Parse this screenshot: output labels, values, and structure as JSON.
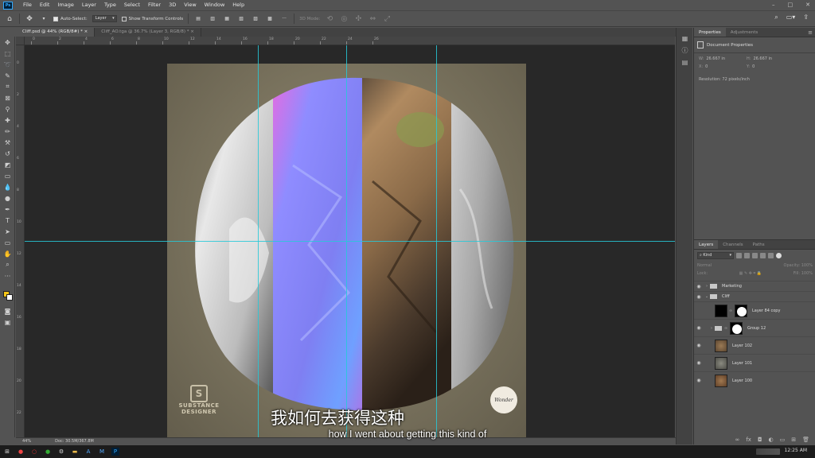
{
  "menubar": {
    "app_logo": "Ps",
    "items": [
      "File",
      "Edit",
      "Image",
      "Layer",
      "Type",
      "Select",
      "Filter",
      "3D",
      "View",
      "Window",
      "Help"
    ],
    "window_controls": [
      "–",
      "□",
      "✕"
    ]
  },
  "options": {
    "auto_select_label": "Auto-Select:",
    "auto_select_value": "Layer",
    "transform_label": "Show Transform Controls",
    "mode_label": "3D Mode:"
  },
  "doc_tabs": [
    {
      "label": "Cliff.psd @ 44% (RGB/8#) *",
      "active": true
    },
    {
      "label": "Cliff_AO.tga @ 36.7% (Layer 3, RGB/8) *",
      "active": false
    }
  ],
  "ruler_top_labels": [
    "0",
    "2",
    "4",
    "6",
    "8",
    "10",
    "12",
    "14",
    "16",
    "18",
    "20",
    "22",
    "24",
    "26"
  ],
  "ruler_left_labels": [
    "0",
    "2",
    "4",
    "6",
    "8",
    "10",
    "12",
    "14",
    "16",
    "18",
    "20",
    "22"
  ],
  "canvas": {
    "logo_substance": "SUBSTANCE",
    "logo_designer": "DESIGNER",
    "logo_mark": "S",
    "stamp_text": "Wonder"
  },
  "subtitles": {
    "cn": "我如何去获得这种",
    "en": "how I went about getting this kind of"
  },
  "status": {
    "zoom": "44%",
    "doc": "Doc: 30.5M/367.8M"
  },
  "properties": {
    "tabs": [
      "Properties",
      "Adjustments"
    ],
    "title": "Document Properties",
    "w_key": "W:",
    "w_value": "26.667 in",
    "h_key": "H:",
    "h_value": "26.667 in",
    "x_key": "X:",
    "x_value": "0",
    "y_key": "Y:",
    "y_value": "0",
    "resolution": "Resolution: 72 pixels/inch"
  },
  "layers_panel": {
    "tabs": [
      "Layers",
      "Channels",
      "Paths"
    ],
    "kind_label": "Kind",
    "blend_mode": "Normal",
    "opacity_label": "Opacity:",
    "opacity_value": "100%",
    "lock_label": "Lock:",
    "fill_label": "Fill:",
    "fill_value": "100%",
    "layers": [
      {
        "name": "Marketing",
        "type": "group",
        "visible": true,
        "expanded": false
      },
      {
        "name": "Cliff",
        "type": "group",
        "visible": true,
        "expanded": true
      },
      {
        "name": "Layer 84 copy",
        "type": "masked",
        "visible": false
      },
      {
        "name": "Group 12",
        "type": "group-masked",
        "visible": true
      },
      {
        "name": "Layer 102",
        "type": "image",
        "visible": true
      },
      {
        "name": "Layer 101",
        "type": "image",
        "visible": true
      },
      {
        "name": "Layer 100",
        "type": "image",
        "visible": true
      }
    ]
  },
  "taskbar": {
    "time": "12:25 AM"
  }
}
